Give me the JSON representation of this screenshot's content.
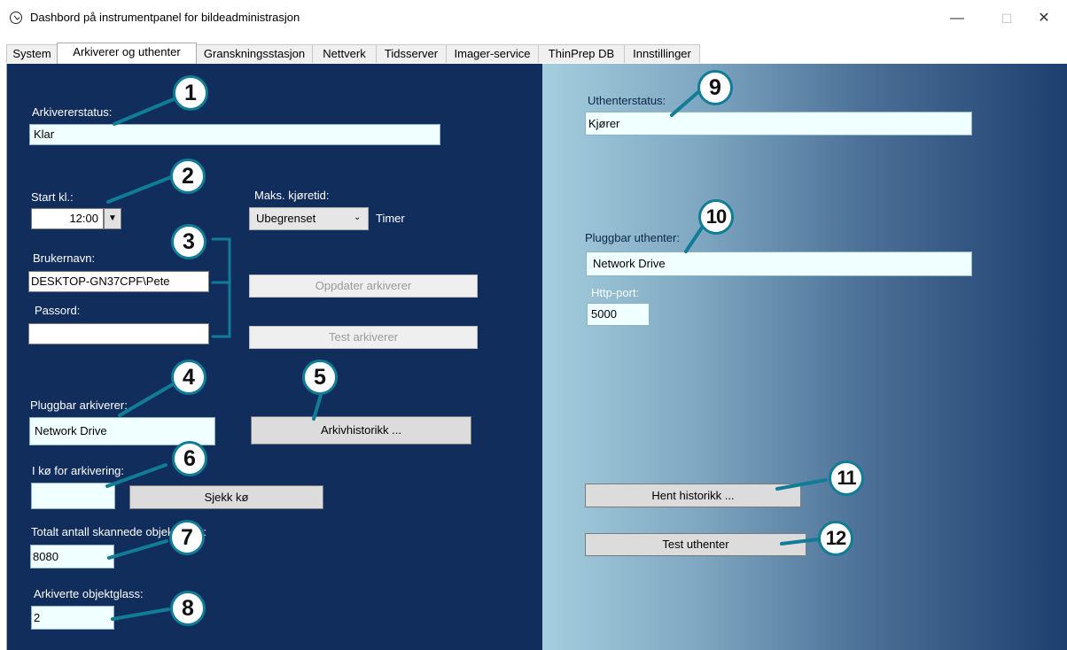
{
  "window": {
    "title": "Dashbord på instrumentpanel for bildeadministrasjon",
    "icon": "clock-icon",
    "controls": {
      "minimize": "—",
      "maximize": "☐",
      "close": "✕"
    }
  },
  "tabs": [
    {
      "label": "System"
    },
    {
      "label": "Arkiverer og uthenter",
      "active": true
    },
    {
      "label": "Granskningsstasjon"
    },
    {
      "label": "Nettverk"
    },
    {
      "label": "Tidsserver"
    },
    {
      "label": "Imager-service"
    },
    {
      "label": "ThinPrep DB"
    },
    {
      "label": "Innstillinger"
    }
  ],
  "archiver": {
    "status_label": "Arkivererstatus:",
    "status_value": "Klar",
    "start_label": "Start kl.:",
    "start_value": "12:00",
    "max_runtime_label": "Maks. kjøretid:",
    "max_runtime_value": "Ubegrenset",
    "max_runtime_unit": "Timer",
    "username_label": "Brukernavn:",
    "username_value": "DESKTOP-GN37CPF\\Pete",
    "password_label": "Passord:",
    "password_value": "",
    "update_button": "Oppdater arkiverer",
    "test_button": "Test arkiverer",
    "pluggable_label": "Pluggbar arkiverer:",
    "pluggable_value": "Network Drive",
    "history_button": "Arkivhistorikk ...",
    "queue_label": "I kø for arkivering:",
    "queue_value": "",
    "check_queue_button": "Sjekk kø",
    "total_scanned_label": "Totalt antall skannede objektglass:",
    "total_scanned_value": "8080",
    "archived_label": "Arkiverte objektglass:",
    "archived_value": "2"
  },
  "retriever": {
    "status_label": "Uthenterstatus:",
    "status_value": "Kjører",
    "pluggable_label": "Pluggbar uthenter:",
    "pluggable_value": "Network Drive",
    "http_port_label": "Http-port:",
    "http_port_value": "5000",
    "history_button": "Hent historikk ...",
    "test_button": "Test uthenter"
  },
  "callouts": [
    "1",
    "2",
    "3",
    "4",
    "5",
    "6",
    "7",
    "8",
    "9",
    "10",
    "11",
    "12"
  ],
  "colors": {
    "left_panel": "#102d5c",
    "callout_ring": "#117c96",
    "field_bg": "#f0ffff"
  }
}
